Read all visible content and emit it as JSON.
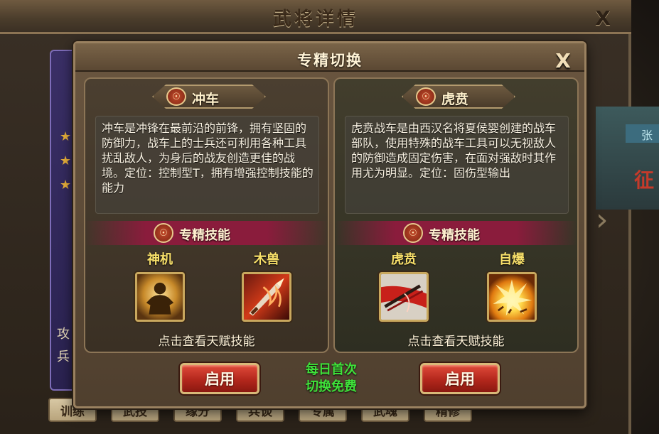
{
  "background_window": {
    "title": "武将详情",
    "close_label": "X",
    "side_labels": [
      "攻",
      "兵"
    ],
    "right_tab": "张",
    "right_name": "征",
    "tabs": [
      "训练",
      "武技",
      "缘分",
      "兵谈",
      "专属",
      "武魂",
      "精修"
    ]
  },
  "modal": {
    "title": "专精切换",
    "close_label": "X",
    "free_note_line1": "每日首次",
    "free_note_line2": "切换免费"
  },
  "cards": [
    {
      "badge_icon": "spec-emblem-icon",
      "name": "冲车",
      "description": "冲车是冲锋在最前沿的前锋，拥有坚固的防御力，战车上的士兵还可利用各种工具扰乱敌人，为身后的战友创造更佳的战境。定位：控制型T，拥有增强控制技能的能力",
      "skills_header": "专精技能",
      "skills": [
        {
          "name": "神机",
          "icon": "golden-guardian-icon"
        },
        {
          "name": "木兽",
          "icon": "flaming-sword-icon"
        }
      ],
      "hint": "点击查看天赋技能",
      "button_label": "启用"
    },
    {
      "badge_icon": "spec-emblem-icon",
      "name": "虎贲",
      "description": "虎贲战车是由西汉名将夏侯婴创建的战车部队，使用特殊的战车工具可以无视敌人的防御造成固定伤害，在面对强敌时其作用尤为明显。定位：固伤型输出",
      "skills_header": "专精技能",
      "skills": [
        {
          "name": "虎贲",
          "icon": "crimson-slash-icon"
        },
        {
          "name": "自爆",
          "icon": "explosion-icon"
        }
      ],
      "hint": "点击查看天赋技能",
      "button_label": "启用"
    }
  ],
  "colors": {
    "skill_name": "#f8e06a",
    "free_note": "#3fe23a",
    "button": "#b3271c",
    "skills_band": "#8a1c3c"
  }
}
